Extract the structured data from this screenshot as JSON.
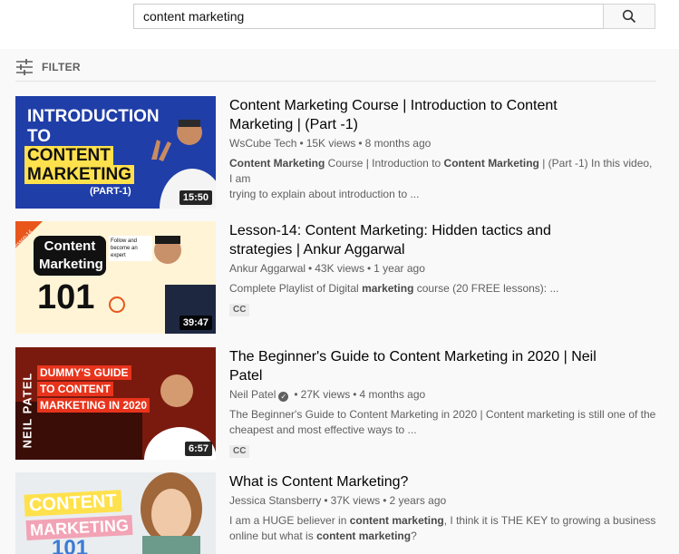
{
  "search": {
    "query": "content marketing"
  },
  "filter": {
    "label": "FILTER"
  },
  "results": [
    {
      "title_line1": "Content Marketing Course | Introduction to Content",
      "title_line2": "Marketing | (Part -1)",
      "channel": "WsCube Tech",
      "views": "15K views",
      "age": "8 months ago",
      "duration": "15:50",
      "desc_line1_parts": [
        "Content Marketing",
        " Course | Introduction to ",
        "Content Marketing",
        " | (Part -1) In this video, I am"
      ],
      "desc_line2": "trying to explain about introduction to ...",
      "thumb_text": [
        "INTRODUCTION",
        "TO",
        "CONTENT",
        "MARKETING",
        "(PART-1)"
      ]
    },
    {
      "title_line1": "Lesson-14: Content Marketing: Hidden tactics and",
      "title_line2": "strategies | Ankur Aggarwal",
      "channel": "Ankur Aggarwal",
      "views": "43K views",
      "age": "1 year ago",
      "duration": "39:47",
      "desc_parts": [
        "Complete Playlist of Digital ",
        "marketing",
        " course (20 FREE lessons): ..."
      ],
      "badge": "CC",
      "thumb_text": [
        "Content",
        "Marketing",
        "101",
        "Lesson-14",
        "Follow and become an expert"
      ]
    },
    {
      "title_line1": "The Beginner's Guide to Content Marketing in 2020 | Neil",
      "title_line2": "Patel",
      "channel": "Neil Patel",
      "verified_glyph": "✓",
      "views": "27K views",
      "age": "4 months ago",
      "duration": "6:57",
      "desc_line1": "The Beginner's Guide to Content Marketing in 2020 | Content marketing is still one of the",
      "desc_line2": "cheapest and most effective ways to ...",
      "badge": "CC",
      "thumb_text": [
        "DUMMY'S GUIDE",
        "TO CONTENT",
        "MARKETING IN 2020",
        "NEIL PATEL"
      ]
    },
    {
      "title_line1": "What is Content Marketing?",
      "channel": "Jessica Stansberry",
      "views": "37K views",
      "age": "2 years ago",
      "desc_line1_parts": [
        "I am a HUGE believer in ",
        "content marketing",
        ", I think it is THE KEY to growing a business"
      ],
      "desc_line2_parts": [
        "online but what is ",
        "content marketing",
        "?"
      ],
      "thumb_text": [
        "CONTENT",
        "MARKETING",
        "101"
      ]
    }
  ],
  "meta_separator": "•",
  "colors": {
    "accent_yellow": "#ffe14d",
    "youtube_gray": "#606060",
    "thumb1_blue": "#1f3ea8",
    "thumb3_red": "#e8341c"
  },
  "icons": {
    "search": "search-icon",
    "filter": "filter-sliders-icon"
  }
}
